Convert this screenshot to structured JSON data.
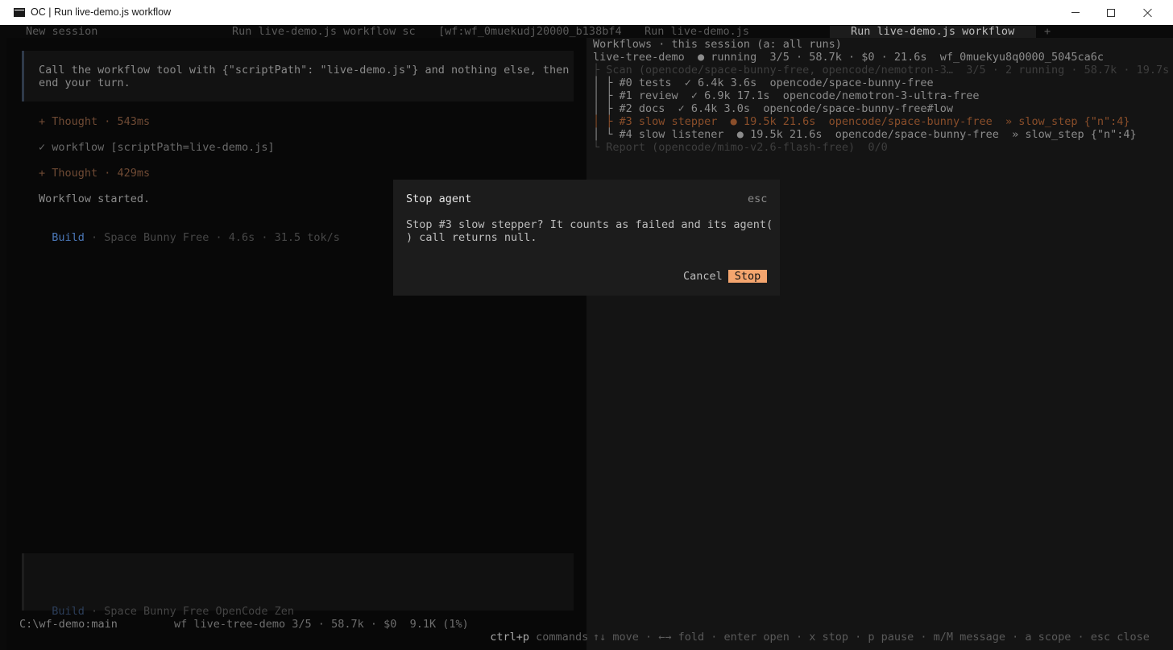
{
  "window": {
    "title": "OC | Run live-demo.js workflow"
  },
  "tabs": {
    "new_session": "New session",
    "run_truncated": "Run live-demo.js workflow sc",
    "wf_id_truncated": "[wf:wf_0muekudj20000_b138bf4",
    "run_file": "Run live-demo.js",
    "run_active": "Run live-demo.js workflow",
    "add": "+"
  },
  "left": {
    "prompt": {
      "line1": "Call the workflow tool with {\"scriptPath\": \"live-demo.js\"} and nothing else, then",
      "line2": "end your turn."
    },
    "thought1": "+ Thought · 543ms",
    "tool_call": "✓ workflow [scriptPath=live-demo.js]",
    "thought2": "+ Thought · 429ms",
    "started": "Workflow started.",
    "build_label": "Build",
    "build_meta": " · Space Bunny Free · 4.6s · 31.5 tok/s",
    "input": {
      "mode": "Build",
      "model": " · Space Bunny Free OpenCode Zen"
    },
    "status": {
      "path": "C:\\wf-demo:main",
      "wf": "wf live-tree-demo 3/5 · 58.7k · $0  9.1K (1%)",
      "shortcut_key": "ctrl+p",
      "shortcut_label": " commands"
    }
  },
  "right": {
    "header": "Workflows · this session (a: all runs)",
    "run_summary": "live-tree-demo  ● running  3/5 · 58.7k · $0 · 21.6s  wf_0muekyu8q0000_5045ca6c",
    "scan_row": "├ Scan (opencode/space-bunny-free, opencode/nemotron-3…  3/5 · 2 running · 58.7k · 19.7s",
    "agents": [
      {
        "text": "│ ├ #0 tests  ✓ 6.4k 3.6s  opencode/space-bunny-free",
        "state": "done"
      },
      {
        "text": "│ ├ #1 review  ✓ 6.9k 17.1s  opencode/nemotron-3-ultra-free",
        "state": "done"
      },
      {
        "text": "│ ├ #2 docs  ✓ 6.4k 3.0s  opencode/space-bunny-free#low",
        "state": "done"
      },
      {
        "text": "│ ├ #3 slow stepper  ● 19.5k 21.6s  opencode/space-bunny-free  » slow_step {\"n\":4}",
        "state": "selected"
      },
      {
        "text": "│ └ #4 slow listener  ● 19.5k 21.6s  opencode/space-bunny-free  » slow_step {\"n\":4}",
        "state": "running"
      }
    ],
    "report_row": "└ Report (opencode/mimo-v2.6-flash-free)  0/0",
    "help": "↑↓ move · ←→ fold · enter open · x stop · p pause · m/M message · a scope · esc close"
  },
  "dialog": {
    "title": "Stop agent",
    "esc_hint": "esc",
    "message_line1": "Stop #3 slow stepper? It counts as failed and its agent(",
    "message_line2": ") call returns null.",
    "cancel_label": "Cancel",
    "stop_label": "Stop"
  },
  "colors": {
    "accent_stop": "#f4a56e",
    "build_blue": "#4b78b8",
    "selected_orange": "#8a4e2a"
  }
}
